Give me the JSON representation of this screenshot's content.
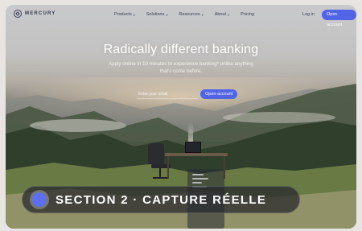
{
  "nav": {
    "logo_text": "MERCURY",
    "links": [
      {
        "label": "Products",
        "has_menu": true
      },
      {
        "label": "Solutions",
        "has_menu": true
      },
      {
        "label": "Resources",
        "has_menu": true
      },
      {
        "label": "About",
        "has_menu": true
      },
      {
        "label": "Pricing",
        "has_menu": false
      }
    ],
    "chevron_glyph": "▾",
    "login_label": "Log in",
    "cta_label": "Open account"
  },
  "hero": {
    "title": "Radically different banking",
    "subtitle": "Apply online in 10 minutes to experience banking* unlike anything that's come before.",
    "email_placeholder": "Enter your email",
    "cta_label": "Open account"
  },
  "overlay": {
    "label": "SECTION 2 · CAPTURE RÉELLE"
  },
  "colors": {
    "accent": "#5164e8",
    "banner_dot": "#5b6ff0"
  }
}
